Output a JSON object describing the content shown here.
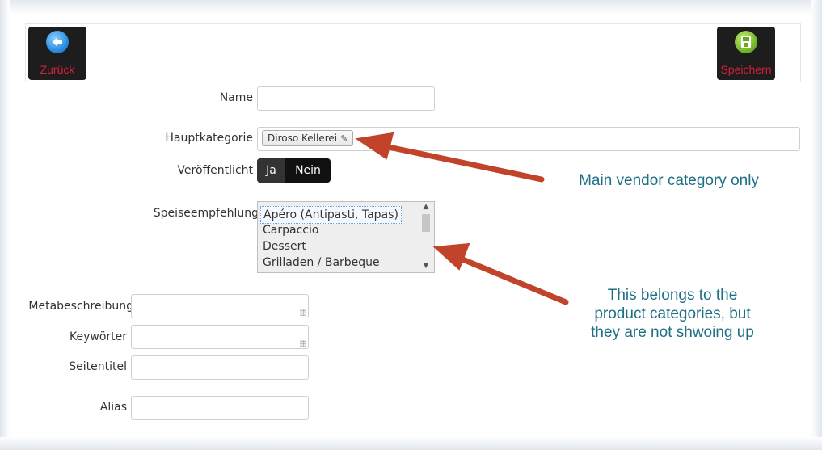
{
  "toolbar": {
    "back_label": "Zurück",
    "save_label": "Speichern",
    "back_icon": "arrow-left-circle-icon",
    "save_icon": "floppy-disk-icon"
  },
  "form": {
    "name_label": "Name",
    "name_value": "",
    "main_category_label": "Hauptkategorie",
    "main_category_tag": "Diroso Kellerei",
    "published_label": "Veröffentlicht",
    "published_yes": "Ja",
    "published_no": "Nein",
    "food_pairing_label": "Speiseempfehlung",
    "food_pairing_options": [
      "Apéro (Antipasti, Tapas)",
      "Carpaccio",
      "Dessert",
      "Grilladen / Barbeque"
    ],
    "meta_description_label": "Metabeschreibung",
    "keywords_label": "Keywörter",
    "page_title_label": "Seitentitel",
    "alias_label": "Alias"
  },
  "annotations": {
    "note1": "Main vendor category only",
    "note2_line1": "This belongs to the",
    "note2_line2": "product categories, but",
    "note2_line3": "they are not shwoing up",
    "arrow_color": "#c0432a",
    "text_color": "#1e6f86"
  },
  "colors": {
    "toolbar_button_bg": "#1d1d1d",
    "toolbar_label": "#d2213a"
  }
}
